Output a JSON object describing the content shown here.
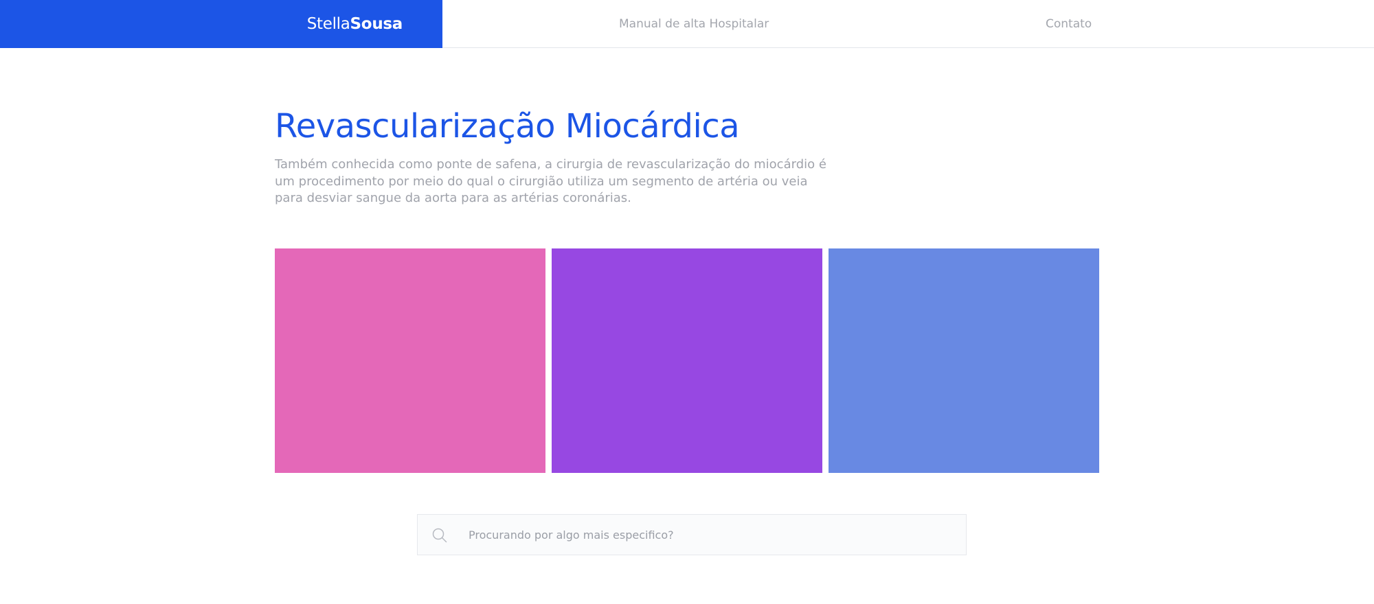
{
  "nav": {
    "brand_part1": "Stella",
    "brand_part2": "Sousa",
    "links": [
      {
        "label": "Manual de alta Hospitalar"
      },
      {
        "label": "Contato"
      }
    ]
  },
  "main": {
    "title": "Revascularização Miocárdica",
    "description": "Também conhecida como ponte de safena, a cirurgia de revascularização do miocárdio é um procedimento por meio do qual o cirurgião utiliza um segmento de artéria ou veia para desviar sangue da aorta para as artérias coronárias."
  },
  "cards": [
    {
      "color": "#e468b8"
    },
    {
      "color": "#9748e2"
    },
    {
      "color": "#6889e3"
    }
  ],
  "search": {
    "placeholder": "Procurando por algo mais especifico?",
    "value": "",
    "icon": "search-icon"
  },
  "colors": {
    "brand": "#1c55e6",
    "nav_text": "#a3a6ad",
    "body_text": "#a0a3ab"
  }
}
